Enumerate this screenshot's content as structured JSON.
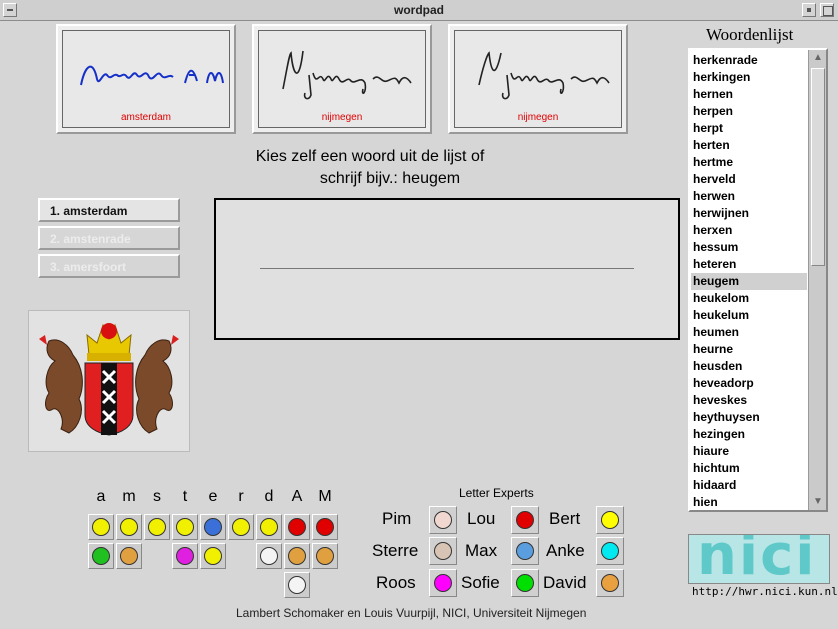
{
  "window": {
    "title": "wordpad"
  },
  "samples": [
    {
      "caption": "amsterdam"
    },
    {
      "caption": "nijmegen"
    },
    {
      "caption": "nijmegen"
    }
  ],
  "prompt": {
    "line1": "Kies zelf een woord uit de lijst of",
    "line2": "schrijf bijv.:  heugem"
  },
  "candidates": [
    "1. amsterdam",
    "2. amstenrade",
    "3. amersfoort"
  ],
  "wordlist": {
    "title": "Woordenlijst",
    "selected": "heugem",
    "items": [
      "herkenrade",
      "herkingen",
      "hernen",
      "herpen",
      "herpt",
      "herten",
      "hertme",
      "herveld",
      "herwen",
      "herwijnen",
      "herxen",
      "hessum",
      "heteren",
      "heugem",
      "heukelom",
      "heukelum",
      "heumen",
      "heurne",
      "heusden",
      "heveadorp",
      "heveskes",
      "heythuysen",
      "hezingen",
      "hiaure",
      "hichtum",
      "hidaard",
      "hien"
    ]
  },
  "letters": {
    "headers": [
      "a",
      "m",
      "s",
      "t",
      "e",
      "r",
      "d",
      "A",
      "M"
    ]
  },
  "experts": {
    "title": "Letter Experts",
    "items": [
      {
        "name": "Pim",
        "color": "#f0d8d0"
      },
      {
        "name": "Lou",
        "color": "#e00000"
      },
      {
        "name": "Bert",
        "color": "#ffff00"
      },
      {
        "name": "Sterre",
        "color": "#d8c4b4"
      },
      {
        "name": "Max",
        "color": "#5a9ee0"
      },
      {
        "name": "Anke",
        "color": "#00e8f0"
      },
      {
        "name": "Roos",
        "color": "#ff00ff"
      },
      {
        "name": "Sofie",
        "color": "#00e000"
      },
      {
        "name": "David",
        "color": "#e8a040"
      }
    ]
  },
  "logo": {
    "text": "nici",
    "url": "http://hwr.nici.kun.nl"
  },
  "credits": "Lambert Schomaker en Louis Vuurpijl, NICI, Universiteit Nijmegen"
}
